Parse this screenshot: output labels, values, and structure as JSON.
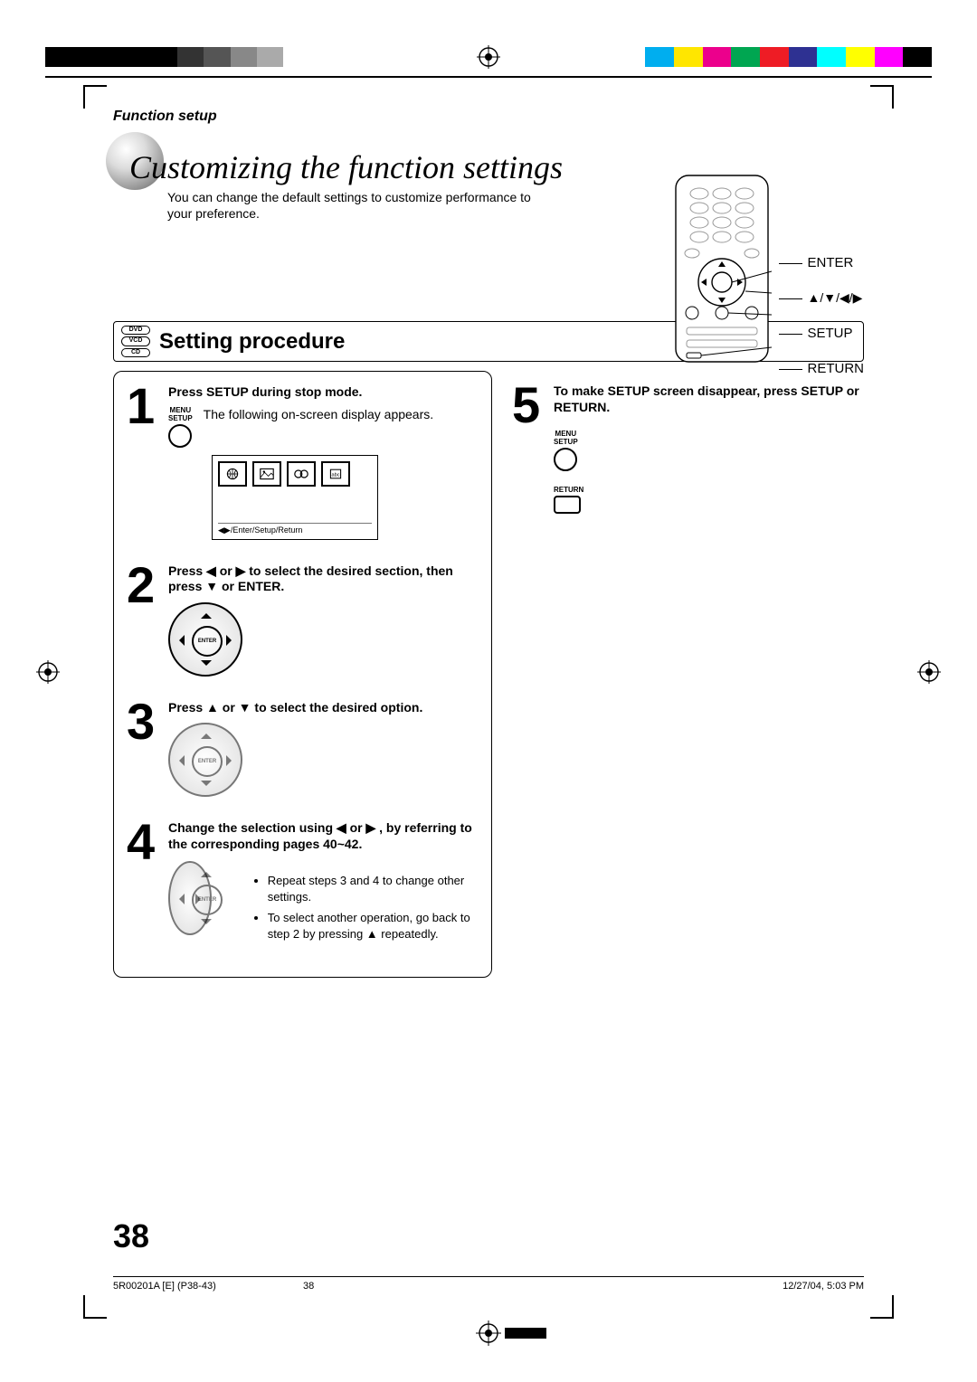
{
  "header": {
    "section_label": "Function setup",
    "page_title": "Customizing the function settings",
    "intro": "You can change the default settings to customize performance to your preference."
  },
  "remote_labels": {
    "enter": "ENTER",
    "arrows": "▲/▼/◀/▶",
    "setup": "SETUP",
    "return": "RETURN"
  },
  "disc_types": {
    "dvd": "DVD",
    "vcd": "VCD",
    "cd": "CD"
  },
  "procedure_heading": "Setting procedure",
  "steps": {
    "s1_num": "1",
    "s1_title": "Press SETUP during stop mode.",
    "s1_btn_label_top": "MENU",
    "s1_btn_label_bottom": "SETUP",
    "s1_desc": "The following on-screen display appears.",
    "s1_osd_caption": "◀▶/Enter/Setup/Return",
    "s2_num": "2",
    "s2_title": "Press ◀ or ▶ to select the desired section, then press ▼ or ENTER.",
    "s3_num": "3",
    "s3_title": "Press ▲ or ▼ to select the desired option.",
    "s4_num": "4",
    "s4_title": "Change the selection using ◀ or ▶ , by referring to the corresponding pages 40~42.",
    "s4_note_a": "Repeat steps 3 and 4 to change other settings.",
    "s4_note_b": "To select another operation, go back to step 2 by pressing ▲ repeatedly.",
    "s5_num": "5",
    "s5_title": "To make SETUP screen disappear, press SETUP or RETURN.",
    "s5_btn1_top": "MENU",
    "s5_btn1_bottom": "SETUP",
    "s5_btn2_label": "RETURN"
  },
  "dpad_center_label": "ENTER",
  "page_number": "38",
  "footer": {
    "filename": "5R00201A [E] (P38-43)",
    "num": "38",
    "date": "12/27/04, 5:03 PM"
  }
}
